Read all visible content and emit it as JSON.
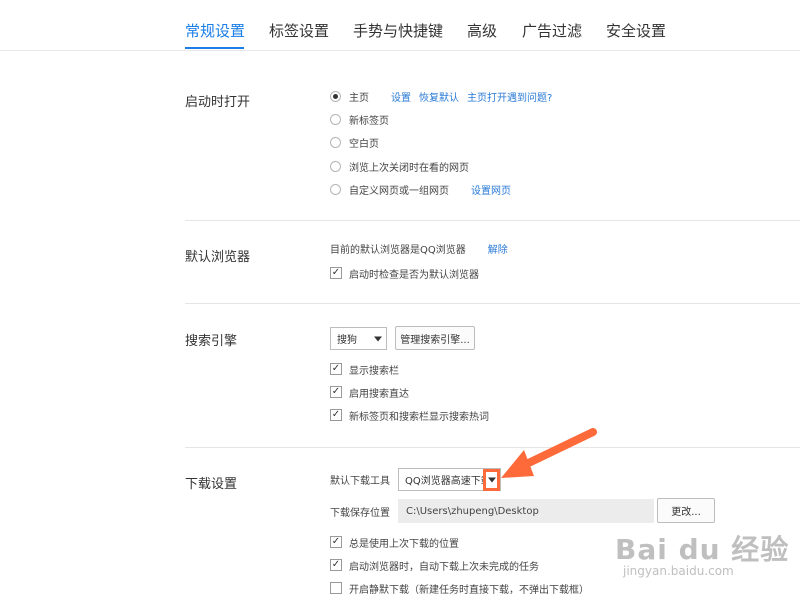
{
  "tabs": [
    "常规设置",
    "标签设置",
    "手势与快捷键",
    "高级",
    "广告过滤",
    "安全设置"
  ],
  "startup": {
    "title": "启动时打开",
    "options": [
      "主页",
      "新标签页",
      "空白页",
      "浏览上次关闭时在看的网页",
      "自定义网页或一组网页"
    ],
    "selected_index": 0,
    "home_links": [
      "设置",
      "恢复默认",
      "主页打开遇到问题?"
    ],
    "custom_link": "设置网页"
  },
  "default_browser": {
    "title": "默认浏览器",
    "status_text": "目前的默认浏览器是QQ浏览器",
    "unbind_link": "解除",
    "check_label": "启动时检查是否为默认浏览器"
  },
  "search": {
    "title": "搜索引擎",
    "engine": "搜狗",
    "manage_button": "管理搜索引擎...",
    "checks": [
      "显示搜索栏",
      "启用搜索直达",
      "新标签页和搜索栏显示搜索热词"
    ]
  },
  "download": {
    "title": "下载设置",
    "tool_label": "默认下载工具",
    "tool_value": "QQ浏览器高速下载",
    "path_label": "下载保存位置",
    "path_value": "C:\\Users\\zhupeng\\Desktop",
    "change_button": "更改...",
    "checks": [
      {
        "label": "总是使用上次下载的位置",
        "checked": true
      },
      {
        "label": "启动浏览器时，自动下载上次未完成的任务",
        "checked": true
      },
      {
        "label": "开启静默下载（新建任务时直接下载，不弹出下载框）",
        "checked": false
      }
    ]
  },
  "watermark": {
    "main": "Bai du 经验",
    "sub": "jingyan.baidu.com"
  },
  "colors": {
    "accent": "#1a7ee6",
    "annotation": "#ff6a3a"
  }
}
